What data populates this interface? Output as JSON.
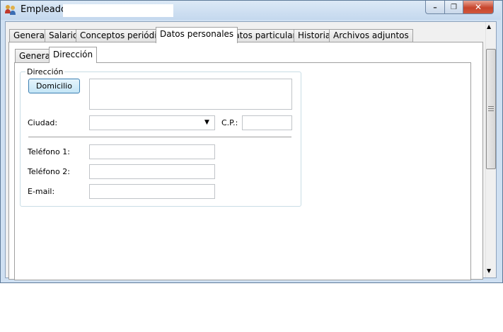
{
  "window": {
    "title": "Empleado -",
    "min_glyph": "–",
    "max_glyph": "❐",
    "close_glyph": "✕"
  },
  "tabs": [
    {
      "label": "General"
    },
    {
      "label": "Salario"
    },
    {
      "label": "Conceptos periódicos"
    },
    {
      "label": "Datos personales",
      "active": true
    },
    {
      "label": "Datos particulares"
    },
    {
      "label": "Historial"
    },
    {
      "label": "Archivos adjuntos"
    }
  ],
  "subtabs": [
    {
      "label": "General"
    },
    {
      "label": "Dirección",
      "active": true
    }
  ],
  "direccion": {
    "group_label": "Dirección",
    "domicilio_button": "Domicilio",
    "domicilio_value": "",
    "ciudad_label": "Ciudad:",
    "ciudad_value": "",
    "cp_label": "C.P.:",
    "cp_value": "",
    "telefono1_label": "Teléfono 1:",
    "telefono1_value": "",
    "telefono2_label": "Teléfono 2:",
    "telefono2_value": "",
    "email_label": "E-mail:",
    "email_value": ""
  },
  "icons": {
    "app": "people-icon",
    "dropdown": "chevron-down-icon",
    "scroll_up": "scroll-up-icon",
    "scroll_down": "scroll-down-icon"
  },
  "colors": {
    "titlebar": "#c4d8ee",
    "close_button": "#c7452c",
    "button_border": "#3c7fb1"
  }
}
